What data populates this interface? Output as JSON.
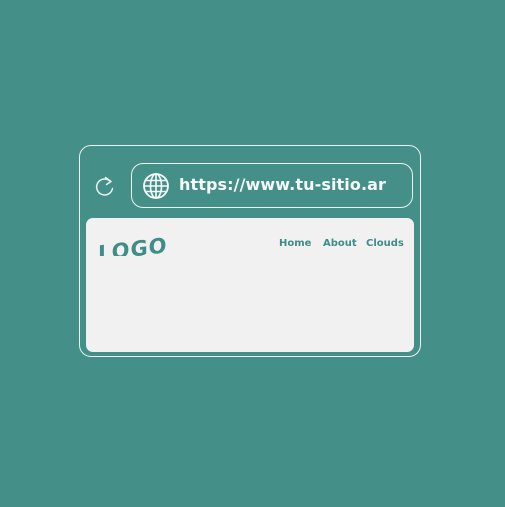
{
  "colors": {
    "background": "#458f89",
    "outline": "#e9f3f1",
    "page": "#f1f1f1",
    "accent": "#3e8d87"
  },
  "toolbar": {
    "reload_icon": "reload-icon",
    "globe_icon": "globe-icon",
    "url": "https://www.tu-sitio.ar"
  },
  "page": {
    "logo": "LOGO",
    "nav": [
      {
        "label": "Home"
      },
      {
        "label": "About"
      },
      {
        "label": "Clouds"
      }
    ]
  }
}
